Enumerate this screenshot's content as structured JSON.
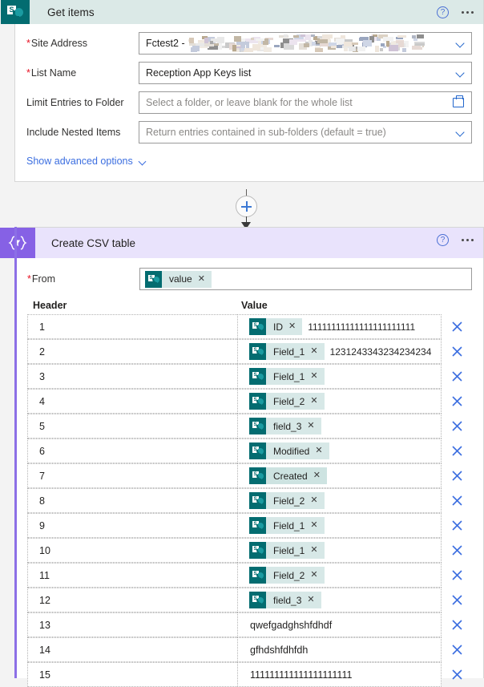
{
  "get_items": {
    "title": "Get items",
    "icon": "sharepoint-icon",
    "help_label": "?",
    "fields": [
      {
        "label": "Site Address",
        "required": true,
        "value": "Fctest2 - ",
        "redacted": true,
        "control": "dropdown",
        "placeholder": ""
      },
      {
        "label": "List Name",
        "required": true,
        "value": "Reception App Keys list",
        "redacted": false,
        "control": "dropdown",
        "placeholder": ""
      },
      {
        "label": "Limit Entries to Folder",
        "required": false,
        "value": "",
        "redacted": false,
        "control": "folder-picker",
        "placeholder": "Select a folder, or leave blank for the whole list"
      },
      {
        "label": "Include Nested Items",
        "required": false,
        "value": "",
        "redacted": false,
        "control": "dropdown",
        "placeholder": "Return entries contained in sub-folders (default = true)"
      }
    ],
    "advanced_options_label": "Show advanced options"
  },
  "connector": {
    "add_step_label": "+"
  },
  "create_csv": {
    "title": "Create CSV table",
    "icon": "data-operation-icon",
    "icon_glyph": "{▽}",
    "help_label": "?",
    "from": {
      "label": "From",
      "required": true,
      "token": {
        "label": "value",
        "icon": "sharepoint-icon",
        "remove_label": "✕"
      }
    },
    "columns": {
      "header": "Header",
      "value": "Value"
    },
    "rows": [
      {
        "header": "1",
        "token": "ID",
        "highlight": false,
        "text": "11111111111111111111111"
      },
      {
        "header": "2",
        "token": "Field_1",
        "highlight": false,
        "text": "1231243343234234234"
      },
      {
        "header": "3",
        "token": "Field_1",
        "highlight": false,
        "text": ""
      },
      {
        "header": "4",
        "token": "Field_2",
        "highlight": false,
        "text": ""
      },
      {
        "header": "5",
        "token": "field_3",
        "highlight": false,
        "text": ""
      },
      {
        "header": "6",
        "token": "Modified",
        "highlight": false,
        "text": ""
      },
      {
        "header": "7",
        "token": "Created",
        "highlight": true,
        "text": ""
      },
      {
        "header": "8",
        "token": "Field_2",
        "highlight": false,
        "text": ""
      },
      {
        "header": "9",
        "token": "Field_1",
        "highlight": false,
        "text": ""
      },
      {
        "header": "10",
        "token": "Field_1",
        "highlight": false,
        "text": ""
      },
      {
        "header": "11",
        "token": "Field_2",
        "highlight": false,
        "text": ""
      },
      {
        "header": "12",
        "token": "field_3",
        "highlight": false,
        "text": ""
      },
      {
        "header": "13",
        "token": "",
        "highlight": false,
        "text": "qwefgadghshfdhdf"
      },
      {
        "header": "14",
        "token": "",
        "highlight": false,
        "text": "gfhdshfdhfdh"
      },
      {
        "header": "15",
        "token": "",
        "highlight": false,
        "text": "111111111111111111111"
      }
    ],
    "remove_row_label": "✕"
  },
  "colors": {
    "sharepoint_teal": "#036c70",
    "csv_purple": "#8661e5",
    "csv_purple_light": "#e9e3fc",
    "getitems_header": "#dbe9e7",
    "link_blue": "#3b6ee0",
    "required_red": "#e81123",
    "token_bg": "#d7e8e7"
  }
}
